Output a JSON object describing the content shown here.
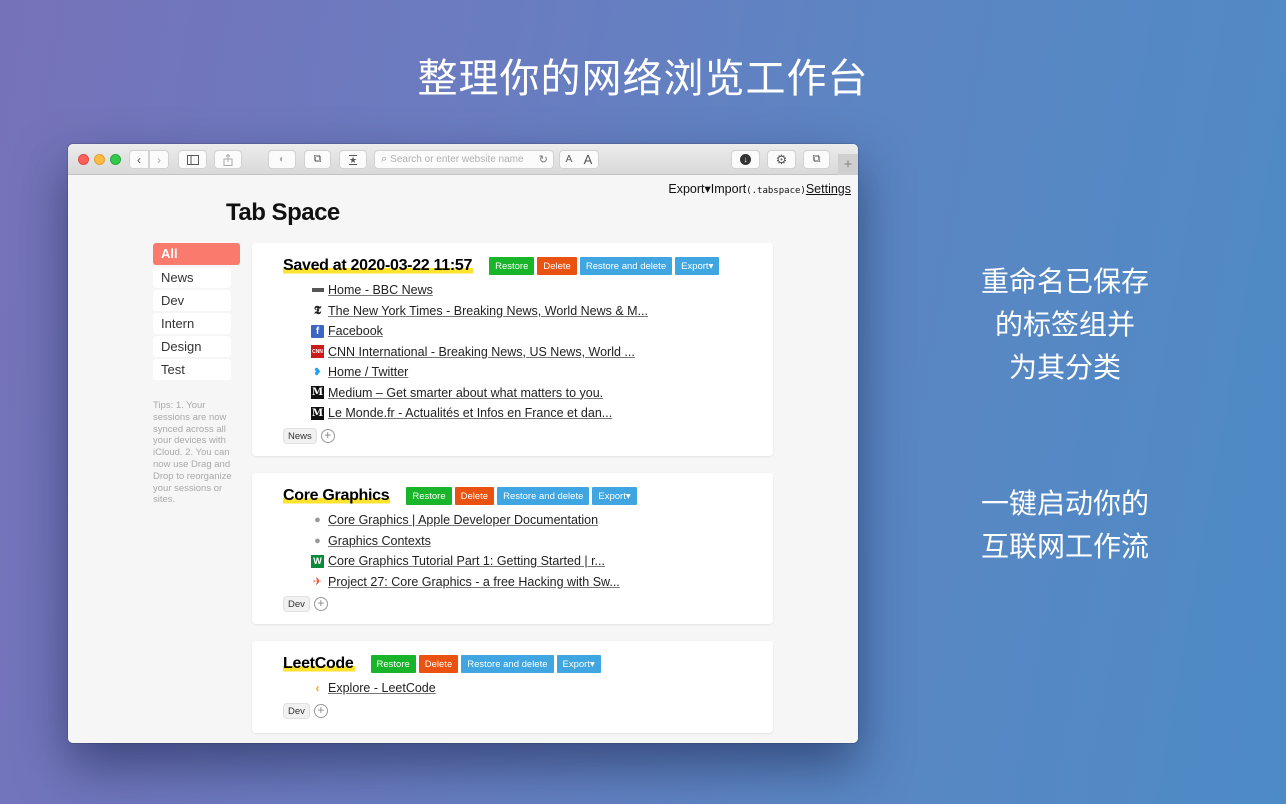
{
  "hero": {
    "title": "整理你的网络浏览工作台",
    "caption1": [
      "重命名已保存",
      "的标签组并",
      "为其分类"
    ],
    "caption2": [
      "一键启动你的",
      "互联网工作流"
    ]
  },
  "browser": {
    "address_placeholder": "Search or enter website name",
    "text_small": "A",
    "text_large": "A",
    "new_tab": "+",
    "icons": [
      "back-icon",
      "forward-icon",
      "sidebar-icon",
      "share-icon",
      "privacy-icon",
      "extension-icon",
      "reader-icon",
      "download-icon",
      "settings-icon",
      "tabs-icon"
    ]
  },
  "app": {
    "title": "Tab Space",
    "nav": {
      "export": "Export▾",
      "import": "Import",
      "import_ext": "(.tabspace)",
      "settings": "Settings"
    },
    "categories": [
      {
        "label": "All",
        "active": true
      },
      {
        "label": "News",
        "active": false
      },
      {
        "label": "Dev",
        "active": false
      },
      {
        "label": "Intern",
        "active": false
      },
      {
        "label": "Design",
        "active": false
      },
      {
        "label": "Test",
        "active": false
      }
    ],
    "tips": "Tips: 1. Your sessions are now synced across all your devices with iCloud. 2. You can now use Drag and Drop to reorganize your sessions or sites.",
    "buttons": {
      "restore": "Restore",
      "delete": "Delete",
      "restore_delete": "Restore and delete",
      "export": "Export▾"
    },
    "add_tag": "+",
    "sessions": [
      {
        "title": "Saved at 2020-03-22 11:57",
        "tag": "News",
        "links": [
          {
            "icon": "bbc-icon",
            "text": "Home - BBC News"
          },
          {
            "icon": "nytimes-icon",
            "text": "The New York Times - Breaking News, World News & M..."
          },
          {
            "icon": "facebook-icon",
            "text": "Facebook"
          },
          {
            "icon": "cnn-icon",
            "text": "CNN International - Breaking News, US News, World ..."
          },
          {
            "icon": "twitter-icon",
            "text": "Home / Twitter"
          },
          {
            "icon": "medium-icon",
            "text": "Medium – Get smarter about what matters to you."
          },
          {
            "icon": "lemonde-icon",
            "text": "Le Monde.fr - Actualités et Infos en France et dan..."
          }
        ]
      },
      {
        "title": "Core Graphics",
        "tag": "Dev",
        "links": [
          {
            "icon": "apple-icon",
            "text": "Core Graphics | Apple Developer Documentation"
          },
          {
            "icon": "apple-icon",
            "text": "Graphics Contexts"
          },
          {
            "icon": "raywenderlich-icon",
            "text": "Core Graphics Tutorial Part 1: Getting Started | r..."
          },
          {
            "icon": "swift-icon",
            "text": "Project 27: Core Graphics - a free Hacking with Sw..."
          }
        ]
      },
      {
        "title": "LeetCode",
        "tag": "Dev",
        "links": [
          {
            "icon": "leetcode-icon",
            "text": "Explore - LeetCode"
          }
        ]
      }
    ]
  },
  "colors": {
    "active_category": "#fa7b6d",
    "restore": "#18b52a",
    "delete": "#ea5211",
    "restore_delete": "#3fa6e2",
    "export": "#3fa6e2",
    "title_highlight": "#fde22f"
  }
}
